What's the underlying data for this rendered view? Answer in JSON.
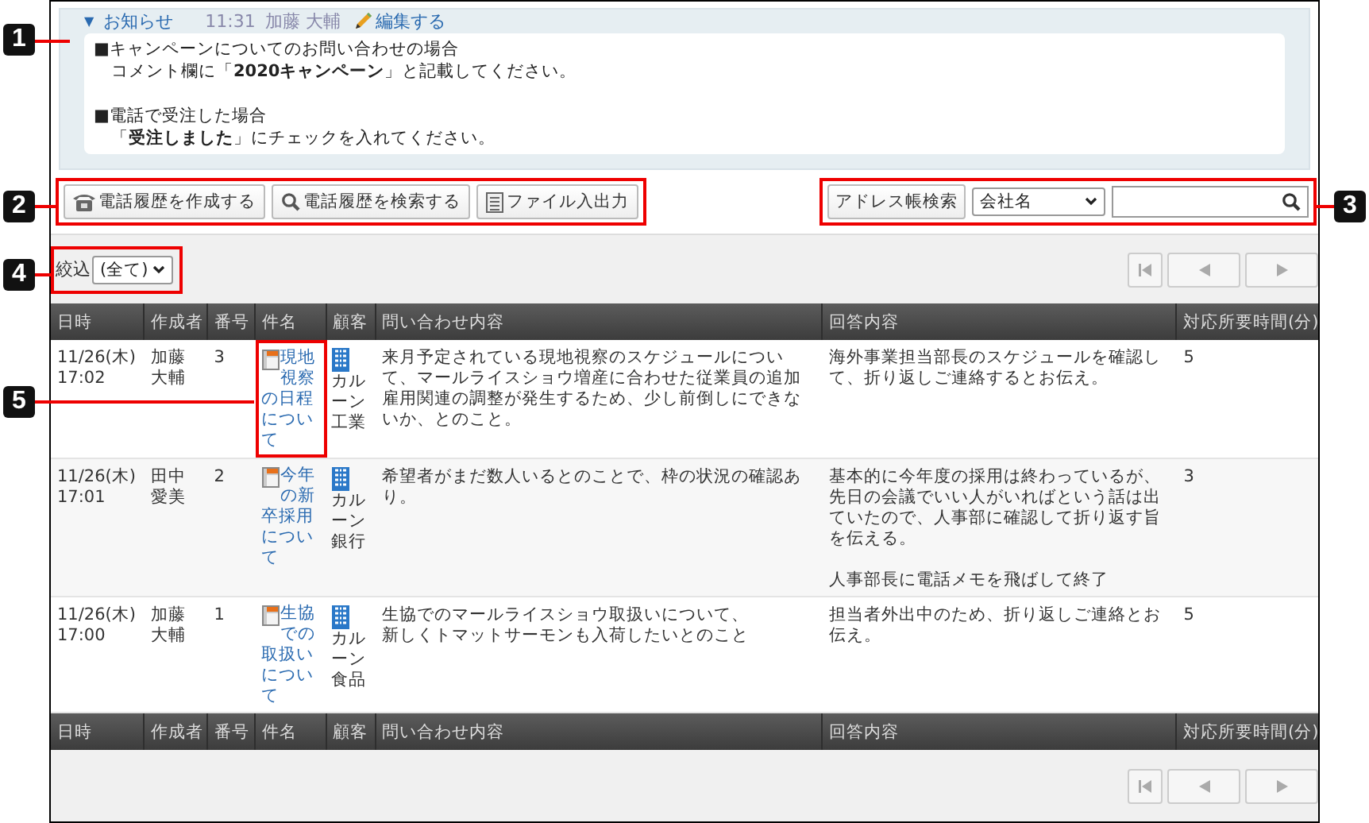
{
  "callouts": [
    "1",
    "2",
    "3",
    "4",
    "5"
  ],
  "notice": {
    "toggle": "▼",
    "title": "お知らせ",
    "time": "11:31",
    "author": "加藤 大輔",
    "edit": "編集する",
    "paragraphs": [
      [
        "■キャンペーンについてのお問い合わせの場合",
        "　コメント欄に「**2020キャンペーン**」と記載してください。"
      ],
      [
        "■電話で受注した場合",
        "　「**受注しました**」にチェックを入れてください。"
      ]
    ]
  },
  "toolbar": [
    {
      "label": "電話履歴を作成する",
      "kind": "phone"
    },
    {
      "label": "電話履歴を検索する",
      "kind": "search"
    },
    {
      "label": "ファイル入出力",
      "kind": "file"
    }
  ],
  "address_search": {
    "button": "アドレス帳検索",
    "select": "会社名"
  },
  "filter": {
    "label": "絞込",
    "select": "(全て)"
  },
  "table": {
    "columns": [
      "日時",
      "作成者",
      "番号",
      "件名",
      "顧客",
      "問い合わせ内容",
      "回答内容",
      "対応所要時間(分)"
    ],
    "rows": [
      {
        "date": "11/26(木)",
        "time": "17:02",
        "author": "加藤大輔",
        "number": "3",
        "subject": "現地視察の日程について",
        "customer": "カルーン工業",
        "inquiry": [
          "来月予定されている現地視察のスケジュールについて、マールライスショウ増産に合わせた従業員の追加雇用関連の調整が発生するため、少し前倒しにできないか、とのこと。"
        ],
        "answer": [
          "海外事業担当部長のスケジュールを確認して、折り返しご連絡するとお伝え。"
        ],
        "minutes": "5"
      },
      {
        "date": "11/26(木)",
        "time": "17:01",
        "author": "田中愛美",
        "number": "2",
        "subject": "今年の新卒採用について",
        "customer": "カルーン銀行",
        "inquiry": [
          "希望者がまだ数人いるとのことで、枠の状況の確認あり。"
        ],
        "answer": [
          "基本的に今年度の採用は終わっているが、先日の会議でいい人がいればという話は出ていたので、人事部に確認して折り返す旨を伝える。",
          "人事部長に電話メモを飛ばして終了"
        ],
        "minutes": "3"
      },
      {
        "date": "11/26(木)",
        "time": "17:00",
        "author": "加藤大輔",
        "number": "1",
        "subject": "生協での取扱いについて",
        "customer": "カルーン食品",
        "inquiry": [
          "生協でのマールライスショウ取扱いについて、",
          "新しくトマットサーモンも入荷したいとのこと"
        ],
        "answer": [
          "担当者外出中のため、折り返しご連絡とお伝え。"
        ],
        "minutes": "5"
      }
    ],
    "footer_columns": [
      "日時",
      "作成者",
      "番号",
      "件名",
      "顧客",
      "問い合わせ内容",
      "回答内容",
      "対応所要時間(分)"
    ]
  }
}
